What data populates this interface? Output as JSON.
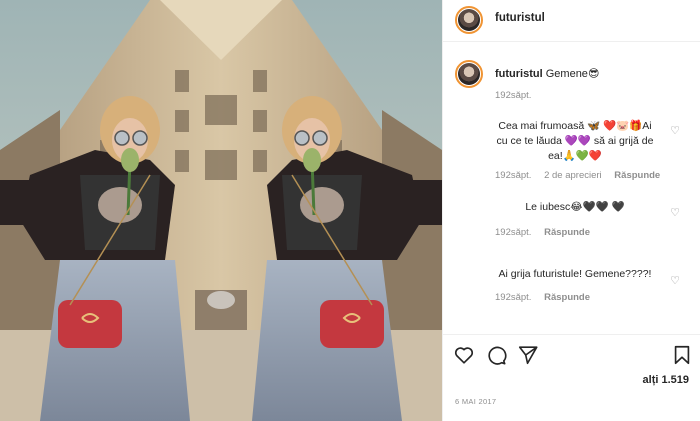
{
  "post": {
    "username": "futuristul",
    "caption_user": "futuristul",
    "caption_text": "Gemene",
    "caption_emoji": "😎",
    "caption_time": "192săpt."
  },
  "comments": [
    {
      "text": "Cea mai frumoasă 🦋 ❤️🐷🎁Ai cu ce te lăuda 💜💜 să ai grijă de ea!🙏💚❤️",
      "time": "192săpt.",
      "likes": "2 de aprecieri",
      "reply": "Răspunde"
    },
    {
      "text": "Le iubesc😂🖤🖤 🖤",
      "time": "192săpt.",
      "likes": "",
      "reply": "Răspunde"
    },
    {
      "text": "Ai grija futuristule! Gemene????!",
      "time": "192săpt.",
      "likes": "",
      "reply": "Răspunde"
    }
  ],
  "footer": {
    "likes": "alți 1.519",
    "date": "6 MAI 2017"
  },
  "icons": {
    "like": "heart-icon",
    "comment": "comment-icon",
    "share": "send-icon",
    "save": "bookmark-icon"
  },
  "colors": {
    "avatar_ring": "#f09433",
    "muted": "#8e8e8e"
  }
}
